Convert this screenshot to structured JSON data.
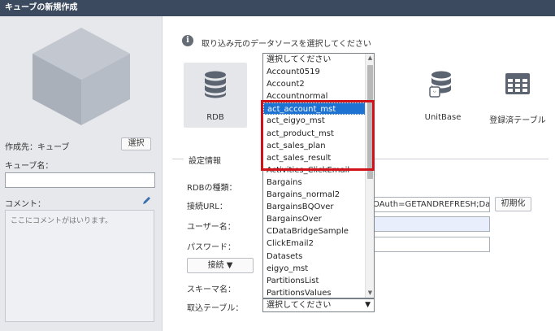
{
  "window": {
    "title": "キューブの新規作成"
  },
  "left_panel": {
    "destination_label": "作成先：キューブ",
    "select_button": "選択",
    "cube_name_label": "キューブ名：",
    "cube_name_value": "",
    "comment_label": "コメント：",
    "comment_placeholder": "ここにコメントがはいります。",
    "cube_icon": "cube-icon",
    "edit_icon": "pencil-icon"
  },
  "main": {
    "instruction": "取り込み元のデータソースを選択してください",
    "sources": [
      {
        "label": "RDB",
        "icon": "database-icon",
        "selected": true
      },
      {
        "label": "UnitBase",
        "icon": "database-plus-icon",
        "selected": false
      },
      {
        "label": "登録済テーブル",
        "icon": "table-icon",
        "selected": false
      }
    ],
    "settings_title": "設定情報",
    "rdb_type_label": "RDBの種類：",
    "url_label": "接続URL：",
    "url_value": "OAuth=GETANDREFRESH;Data:",
    "init_button": "初期化",
    "user_label": "ユーザー名：",
    "password_label": "パスワード：",
    "connect_button": "接続 ▼",
    "schema_label": "スキーマ名：",
    "import_table_label": "取込テーブル：",
    "import_table_value": "選択してください"
  },
  "dropdown": {
    "items": [
      "選択してください",
      "Account0519",
      "Account2",
      "Accountnormal",
      "act_account_mst",
      "act_eigyo_mst",
      "act_product_mst",
      "act_sales_plan",
      "act_sales_result",
      "Activities_ClickEmail",
      "Bargains",
      "Bargains_normal2",
      "BargainsBQOver",
      "BargainsOver",
      "CDataBridgeSample",
      "ClickEmail2",
      "Datasets",
      "eigyo_mst",
      "PartitionsList",
      "PartitionsValues"
    ],
    "selected_index": 4
  },
  "colors": {
    "titlebar": "#3b4a5e",
    "selection": "#1e73d2",
    "highlight": "#d0121b"
  }
}
